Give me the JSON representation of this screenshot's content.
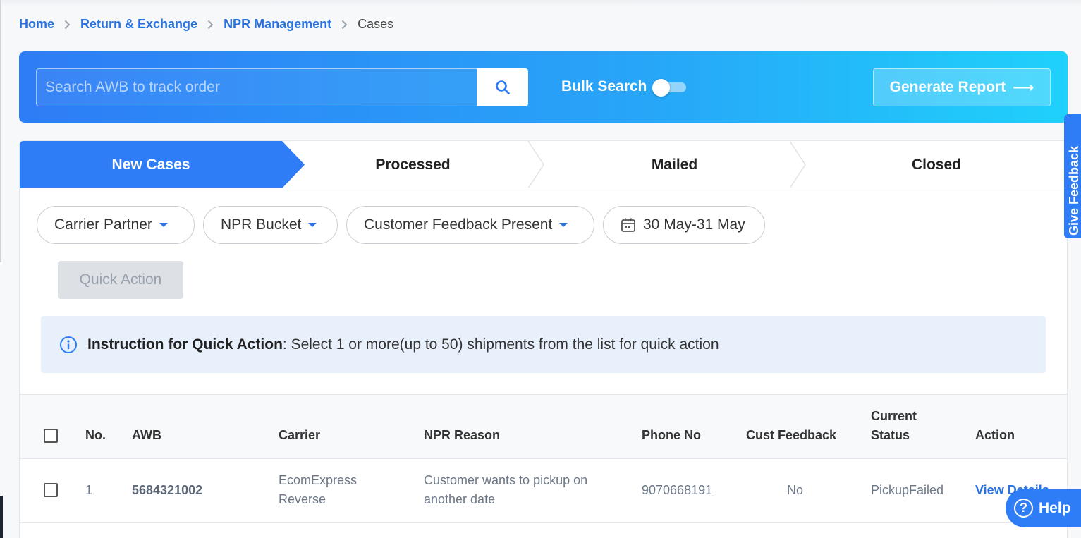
{
  "breadcrumb": {
    "items": [
      "Home",
      "Return & Exchange",
      "NPR Management"
    ],
    "current": "Cases"
  },
  "search": {
    "placeholder": "Search AWB to track order",
    "bulk_label": "Bulk Search",
    "bulk_enabled": false
  },
  "generate_report": {
    "label": "Generate Report",
    "arrow": "⟶"
  },
  "steps": [
    {
      "label": "New Cases",
      "active": true
    },
    {
      "label": "Processed",
      "active": false
    },
    {
      "label": "Mailed",
      "active": false
    },
    {
      "label": "Closed",
      "active": false
    }
  ],
  "filters": {
    "carrier": "Carrier Partner",
    "npr_bucket": "NPR Bucket",
    "feedback": "Customer Feedback Present",
    "date_range": "30 May-31 May"
  },
  "quick_action": {
    "label": "Quick Action"
  },
  "instruction": {
    "title": "Instruction for Quick Action",
    "text": ": Select 1 or more(up to 50) shipments from the list for quick action"
  },
  "table": {
    "headers": {
      "no": "No.",
      "awb": "AWB",
      "carrier": "Carrier",
      "npr_reason": "NPR Reason",
      "phone": "Phone No",
      "feedback": "Cust Feedback",
      "status_line1": "Current",
      "status_line2": "Status",
      "action": "Action"
    },
    "rows": [
      {
        "no": "1",
        "awb": "5684321002",
        "carrier_line1": "EcomExpress",
        "carrier_line2": "Reverse",
        "reason_line1": "Customer wants to pickup on",
        "reason_line2": "another date",
        "phone": "9070668191",
        "feedback": "No",
        "status": "PickupFailed",
        "action": "View Details"
      }
    ]
  },
  "side_tab": {
    "label": "Give Feedback"
  },
  "help": {
    "label": "Help",
    "icon_glyph": "?"
  },
  "colors": {
    "primary": "#2e7cf6",
    "gradient_end": "#1fd1fb",
    "link": "#2a72e0"
  }
}
